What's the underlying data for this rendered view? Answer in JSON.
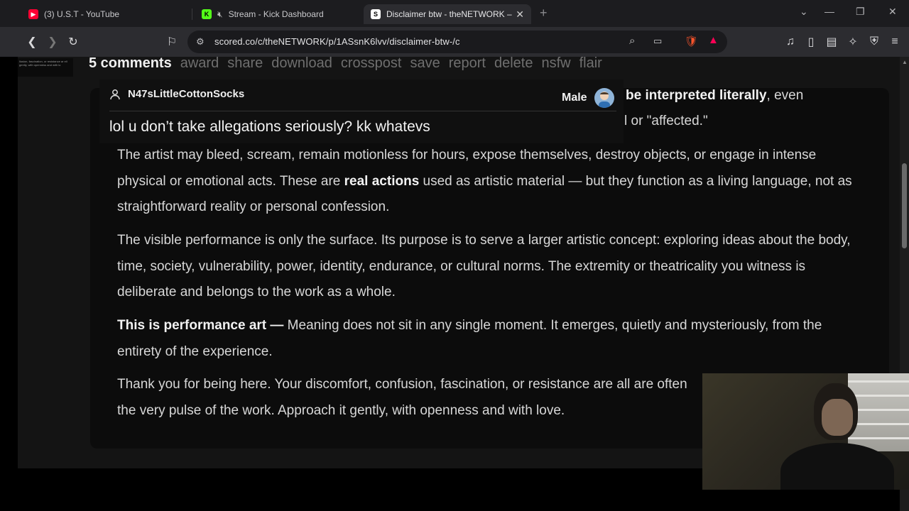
{
  "tabs": [
    {
      "title": "(3) U.S.T - YouTube",
      "icon": "youtube-icon",
      "color": "#ff0033"
    },
    {
      "title": "Stream - Kick Dashboard",
      "icon": "kick-icon",
      "color": "#53fc18"
    },
    {
      "title": "Disclaimer btw - theNETWORK –",
      "icon": "scored-icon",
      "color": "#ffffff"
    }
  ],
  "url": "scored.co/c/theNETWORK/p/1ASsnK6lvv/disclaimer-btw-/c",
  "thumbnail_text": "llusion, fascination, or resistance ar ell gently, with openness and with lo",
  "actions": {
    "count": "5 comments",
    "award": "award",
    "share": "share",
    "download": "download",
    "crosspost": "crosspost",
    "save": "save",
    "report": "report",
    "delete": "delete",
    "nsfw": "nsfw",
    "flair": "flair"
  },
  "overlay": {
    "username": "N47sLittleCottonSocks",
    "gender": "Male",
    "comment": "lol u don’t take allegations seriously? kk whatevs"
  },
  "post": {
    "behind_line1_bold": "be interpreted literally",
    "behind_line1_rest": ", even",
    "behind_line2": "l or \"affected.\"",
    "p1_a": "The artist may bleed, scream, remain motionless for hours, expose themselves, destroy objects, or engage in intense physical or emotional acts. These are ",
    "p1_bold": "real actions",
    "p1_b": " used as artistic material — but they function as a living language, not as straightforward reality or personal confession.",
    "p2": "The visible performance is only the surface. Its purpose is to serve a larger artistic concept: exploring ideas about the body, time, society, vulnerability, power, identity, endurance, or cultural norms. The extremity or theatricality you witness is deliberate and belongs to the work as a whole.",
    "p3_bold": "This is performance art —",
    "p3_rest": " Meaning does not sit in any single moment. It emerges, quietly and mysteriously, from the entirety of the experience.",
    "p4": "Thank you for being here. Your discomfort, confusion, fascination, or resistance are all are often the very pulse of the work. Approach it gently, with openness and with love."
  }
}
